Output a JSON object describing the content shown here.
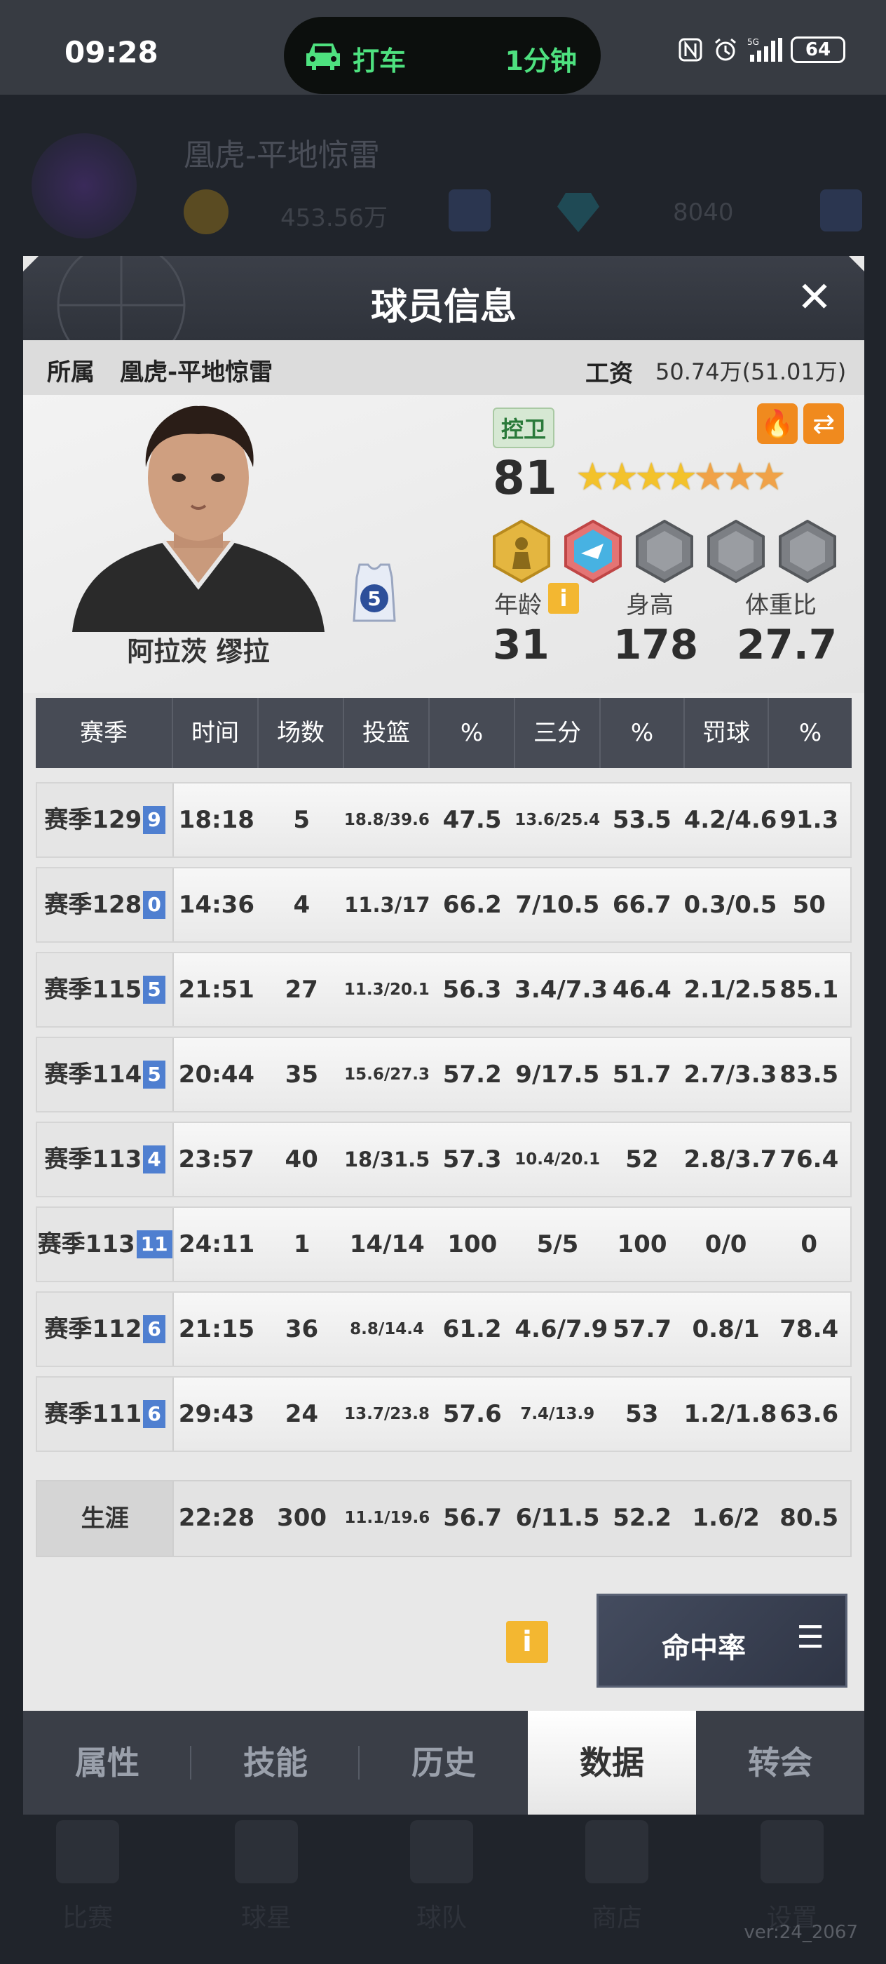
{
  "status": {
    "time": "09:28",
    "taxi": "打车",
    "eta": "1分钟",
    "signal": "5G",
    "battery": "64"
  },
  "background": {
    "team": "凰虎-平地惊雷",
    "coins": "453.56万",
    "gems": "8040",
    "nav": [
      "比赛",
      "球星",
      "球队",
      "商店",
      "设置"
    ],
    "version": "ver:24_2067"
  },
  "modal": {
    "title": "球员信息",
    "close": "✕",
    "team_label": "所属",
    "team": "凰虎-平地惊雷",
    "salary_label": "工资",
    "salary": "50.74万(51.01万)"
  },
  "player": {
    "name": "阿拉茨 缪拉",
    "jersey": "5",
    "position": "控卫",
    "rating": "81",
    "stars": 7,
    "age_label": "年龄",
    "age": "31",
    "height_label": "身高",
    "height": "178",
    "weight_label": "体重比",
    "weight": "27.7",
    "info_icon": "i"
  },
  "table": {
    "headers": [
      "赛季",
      "时间",
      "场数",
      "投篮",
      "%",
      "三分",
      "%",
      "罚球",
      "%"
    ],
    "rows": [
      {
        "season": "赛季129",
        "num": "9",
        "time": "18:18",
        "games": "5",
        "fg": "18.8/39.6",
        "fg_pct": "47.5",
        "three": "13.6/25.4",
        "three_pct": "53.5",
        "ft": "4.2/4.6",
        "ft_pct": "91.3"
      },
      {
        "season": "赛季128",
        "num": "0",
        "time": "14:36",
        "games": "4",
        "fg": "11.3/17",
        "fg_pct": "66.2",
        "three": "7/10.5",
        "three_pct": "66.7",
        "ft": "0.3/0.5",
        "ft_pct": "50"
      },
      {
        "season": "赛季115",
        "num": "5",
        "time": "21:51",
        "games": "27",
        "fg": "11.3/20.1",
        "fg_pct": "56.3",
        "three": "3.4/7.3",
        "three_pct": "46.4",
        "ft": "2.1/2.5",
        "ft_pct": "85.1"
      },
      {
        "season": "赛季114",
        "num": "5",
        "time": "20:44",
        "games": "35",
        "fg": "15.6/27.3",
        "fg_pct": "57.2",
        "three": "9/17.5",
        "three_pct": "51.7",
        "ft": "2.7/3.3",
        "ft_pct": "83.5"
      },
      {
        "season": "赛季113",
        "num": "4",
        "time": "23:57",
        "games": "40",
        "fg": "18/31.5",
        "fg_pct": "57.3",
        "three": "10.4/20.1",
        "three_pct": "52",
        "ft": "2.8/3.7",
        "ft_pct": "76.4"
      },
      {
        "season": "赛季113",
        "num": "11",
        "time": "24:11",
        "games": "1",
        "fg": "14/14",
        "fg_pct": "100",
        "three": "5/5",
        "three_pct": "100",
        "ft": "0/0",
        "ft_pct": "0"
      },
      {
        "season": "赛季112",
        "num": "6",
        "time": "21:15",
        "games": "36",
        "fg": "8.8/14.4",
        "fg_pct": "61.2",
        "three": "4.6/7.9",
        "three_pct": "57.7",
        "ft": "0.8/1",
        "ft_pct": "78.4"
      },
      {
        "season": "赛季111",
        "num": "6",
        "time": "29:43",
        "games": "24",
        "fg": "13.7/23.8",
        "fg_pct": "57.6",
        "three": "7.4/13.9",
        "three_pct": "53",
        "ft": "1.2/1.8",
        "ft_pct": "63.6"
      }
    ],
    "career": {
      "label": "生涯",
      "time": "22:28",
      "games": "300",
      "fg": "11.1/19.6",
      "fg_pct": "56.7",
      "three": "6/11.5",
      "three_pct": "52.2",
      "ft": "1.6/2",
      "ft_pct": "80.5"
    }
  },
  "footer": {
    "hit_rate": "命中率",
    "menu_icon": "☰",
    "info_icon": "i"
  },
  "tabs": [
    "属性",
    "技能",
    "历史",
    "数据",
    "转会"
  ],
  "active_tab": 3
}
